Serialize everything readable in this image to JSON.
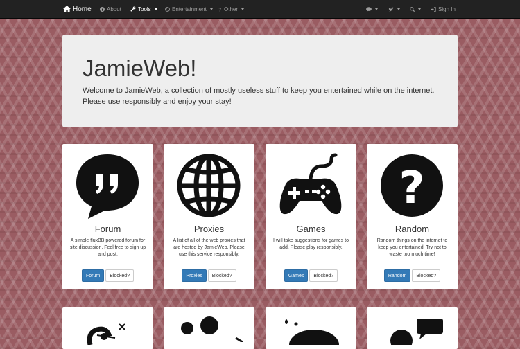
{
  "nav": {
    "home": "Home",
    "about": "About",
    "tools": "Tools",
    "entertainment": "Entertainment",
    "other": "Other",
    "sign_in": "Sign In"
  },
  "jumbotron": {
    "title": "JamieWeb!",
    "text": "Welcome to JamieWeb, a collection of mostly useless stuff to keep you entertained while on the internet. Please use responsibly and enjoy your stay!"
  },
  "cards": [
    {
      "title": "Forum",
      "desc": "A simple fluxBB powered forum for site discussion. Feel free to sign up and post.",
      "button": "Forum",
      "blocked": "Blocked?",
      "icon": "speech-bubble-quote-icon"
    },
    {
      "title": "Proxies",
      "desc": "A list of all of the web proxies that are hosted by JamieWeb. Please use this service responsibly.",
      "button": "Proxies",
      "blocked": "Blocked?",
      "icon": "globe-icon"
    },
    {
      "title": "Games",
      "desc": "I will take suggestions for games to add. Please play responsibly.",
      "button": "Games",
      "blocked": "Blocked?",
      "icon": "gamepad-icon"
    },
    {
      "title": "Random",
      "desc": "Random things on the internet to keep you entertained. Try not to waste too much time!",
      "button": "Random",
      "blocked": "Blocked?",
      "icon": "question-circle-icon"
    }
  ],
  "colors": {
    "navbar": "#222222",
    "primary": "#337ab7",
    "background": "#9a5c62",
    "jumbotron": "#eeeeee"
  }
}
